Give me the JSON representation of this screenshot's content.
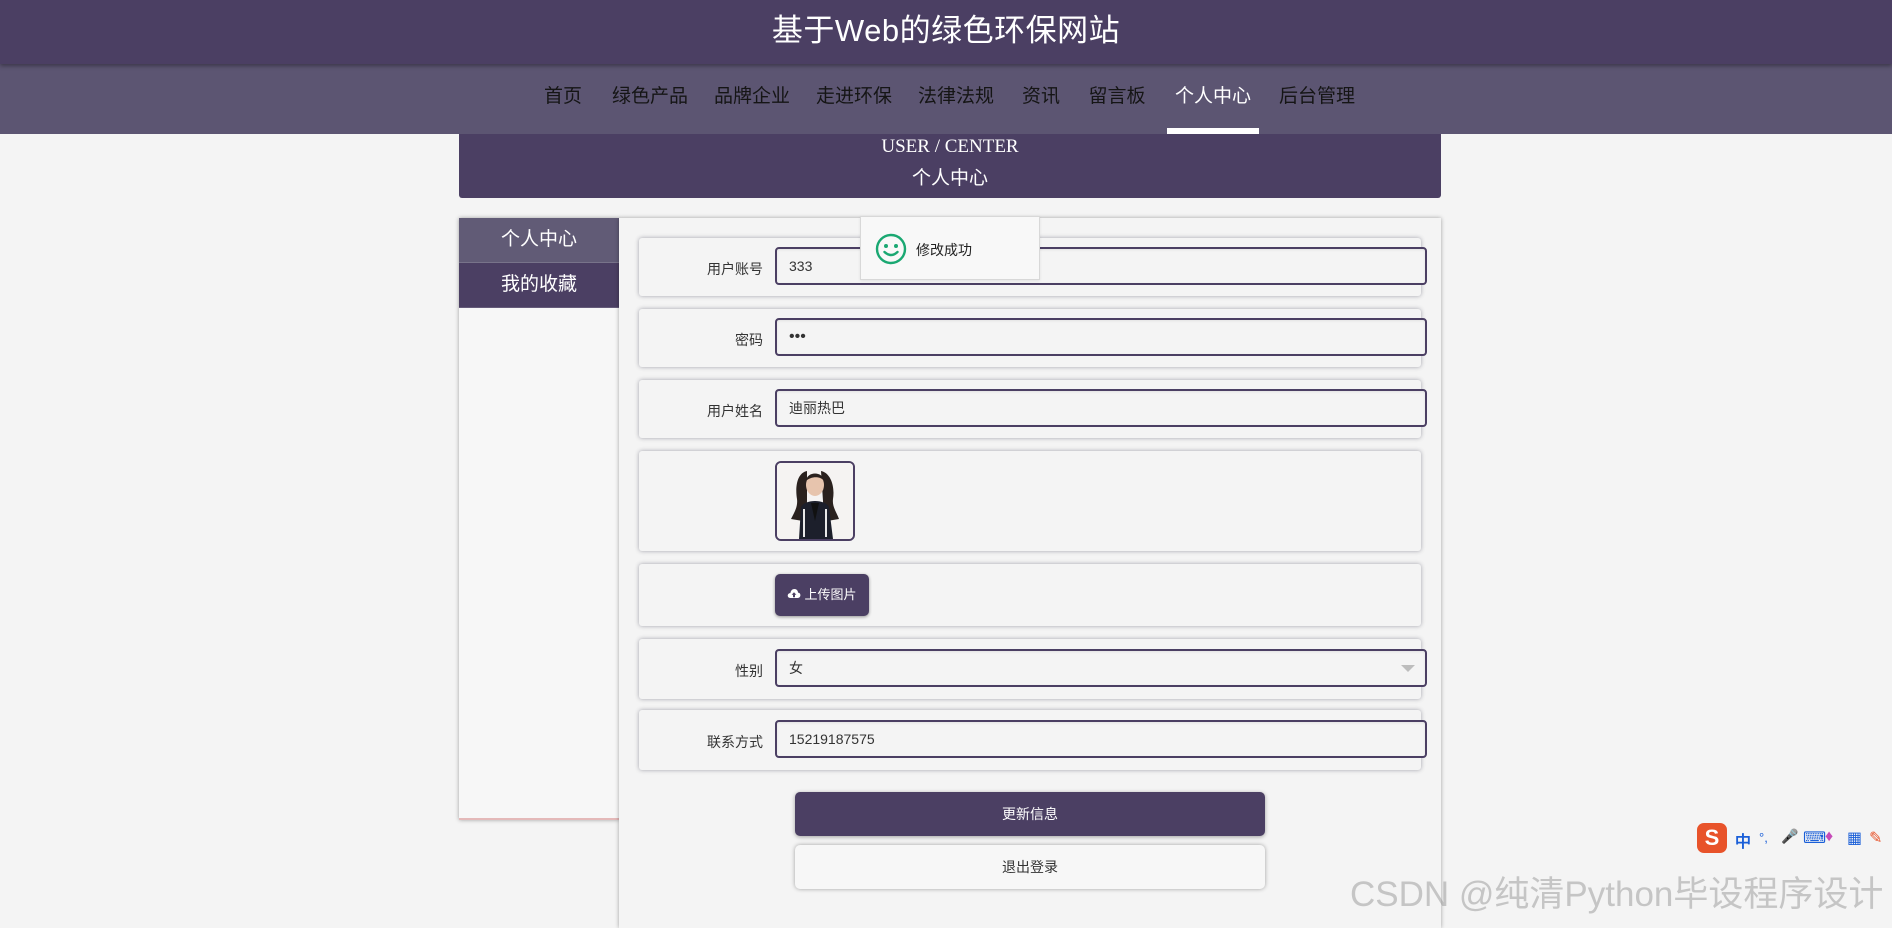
{
  "site": {
    "title": "基于Web的绿色环保网站"
  },
  "nav": {
    "items": [
      {
        "label": "首页"
      },
      {
        "label": "绿色产品"
      },
      {
        "label": "品牌企业"
      },
      {
        "label": "走进环保"
      },
      {
        "label": "法律法规"
      },
      {
        "label": "资讯"
      },
      {
        "label": "留言板"
      },
      {
        "label": "个人中心",
        "active": true
      },
      {
        "label": "后台管理"
      }
    ]
  },
  "banner": {
    "en": "USER / CENTER",
    "cn": "个人中心"
  },
  "sidebar": {
    "items": [
      {
        "label": "个人中心",
        "active": true
      },
      {
        "label": "我的收藏"
      }
    ]
  },
  "form": {
    "account": {
      "label": "用户账号",
      "value": "333"
    },
    "password": {
      "label": "密码",
      "value": "•••"
    },
    "name": {
      "label": "用户姓名",
      "value": "迪丽热巴"
    },
    "upload": {
      "label": "上传图片",
      "icon": "cloud-upload-icon"
    },
    "gender": {
      "label": "性别",
      "value": "女"
    },
    "phone": {
      "label": "联系方式",
      "value": "15219187575"
    },
    "update_button": "更新信息",
    "logout_button": "退出登录"
  },
  "toast": {
    "message": "修改成功",
    "icon": "smile-icon"
  },
  "watermark": "CSDN @纯清Python毕设程序设计",
  "ime": {
    "brand": "S",
    "chars": [
      "中",
      "°,",
      "🎤",
      "⌨",
      "♦",
      "▦",
      "✎"
    ]
  },
  "colors": {
    "primary": "#4b3f63",
    "nav": "#5c5572",
    "success": "#1aa872",
    "background": "#f4f4f4"
  }
}
